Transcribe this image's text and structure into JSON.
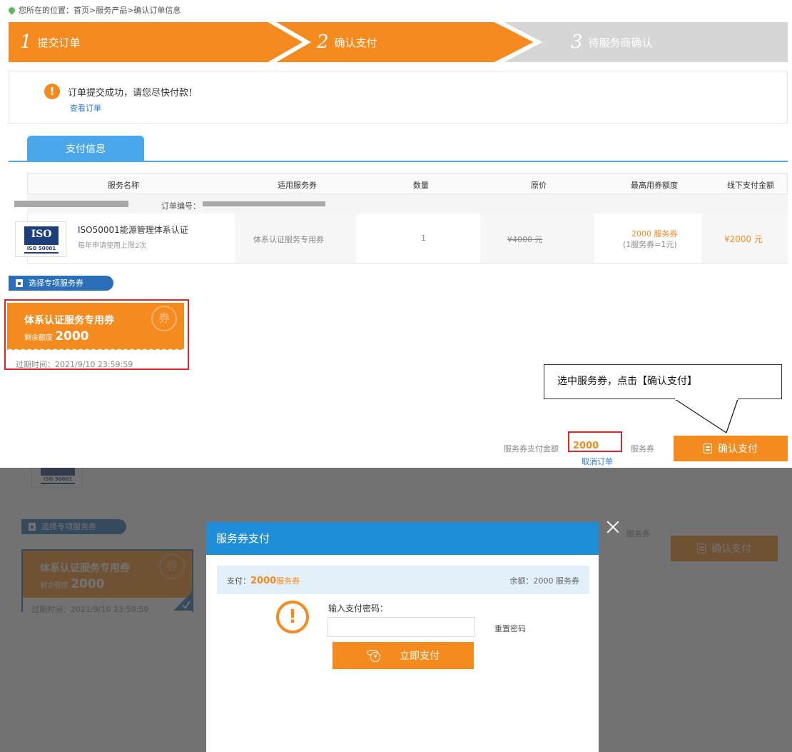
{
  "breadcrumb": {
    "prefix": "您所在的位置：",
    "path": "首页>服务产品>确认订单信息"
  },
  "steps": [
    {
      "num": "1",
      "label": "提交订单"
    },
    {
      "num": "2",
      "label": "确认支付"
    },
    {
      "num": "3",
      "label": "待服务商确认"
    }
  ],
  "colors": {
    "accent_orange": "#f58b1f",
    "blue": "#1f8ed8",
    "step_gray": "#d6d6d6",
    "highlight_red": "#e0242a"
  },
  "notice": {
    "message": "订单提交成功，请您尽快付款！",
    "link": "查看订单"
  },
  "tab": {
    "label": "支付信息"
  },
  "table": {
    "headers": [
      "服务名称",
      "适用服务券",
      "数量",
      "原价",
      "最高用券额度",
      "线下支付金额"
    ],
    "order_no_label": "订单编号：",
    "row": {
      "logo_text": "ISO",
      "logo_sub": "ISO 50001",
      "product_name": "ISO50001能源管理体系认证",
      "limit": "每年申请使用上限2次",
      "coupon_type": "体系认证服务专用券",
      "quantity": "1",
      "original_price": "¥4000 元",
      "max_coupon": "2000 服务券",
      "max_coupon_note": "(1服务券=1元)",
      "offline_amount": "¥2000 元"
    }
  },
  "choose_button": "选择专项服务券",
  "coupon": {
    "title": "体系认证服务专用券",
    "remain_label": "剩余额度",
    "remain_value": "2000",
    "badge": "券",
    "expire": "过期时间：2021/9/10 23:59:59"
  },
  "callout": "选中服务券，点击【确认支付】",
  "footer": {
    "pay_label": "服务券支付金额",
    "pay_value": "2000",
    "unit": "服务券",
    "cancel": "取消订单",
    "confirm": "确认支付"
  },
  "modal": {
    "title": "服务券支付",
    "pay_prefix": "支付：",
    "pay_value": "2000",
    "pay_unit": "服务券",
    "balance": "余额：2000 服务券",
    "password_label": "输入支付密码：",
    "reset": "重置密码",
    "pay_now": "立即支付"
  }
}
